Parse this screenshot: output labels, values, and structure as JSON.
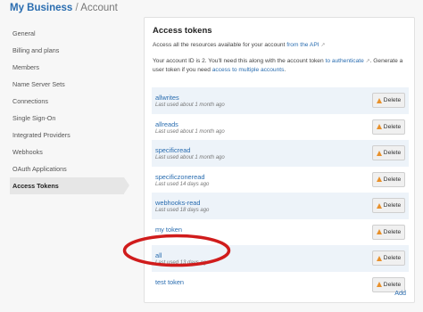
{
  "breadcrumb": {
    "business": "My Business",
    "separator": "/",
    "current": "Account"
  },
  "sidebar": {
    "items": [
      {
        "label": "General",
        "active": false
      },
      {
        "label": "Billing and plans",
        "active": false
      },
      {
        "label": "Members",
        "active": false
      },
      {
        "label": "Name Server Sets",
        "active": false
      },
      {
        "label": "Connections",
        "active": false
      },
      {
        "label": "Single Sign-On",
        "active": false
      },
      {
        "label": "Integrated Providers",
        "active": false
      },
      {
        "label": "Webhooks",
        "active": false
      },
      {
        "label": "OAuth Applications",
        "active": false
      },
      {
        "label": "Access Tokens",
        "active": true
      }
    ]
  },
  "panel": {
    "title": "Access tokens",
    "p1_text": "Access all the resources available for your account",
    "p1_link": "from the API",
    "p2_text_a": "Your account ID is 2. You'll need this along with the account token",
    "p2_link1": "to authenticate",
    "p2_text_b": ". Generate a user token if you need",
    "p2_link2": "access to multiple accounts",
    "p2_text_c": ".",
    "external_icon": "external-link-icon"
  },
  "tokens": [
    {
      "name": "allwrites",
      "last_used": "Last used about 1 month ago"
    },
    {
      "name": "allreads",
      "last_used": "Last used about 1 month ago"
    },
    {
      "name": "specificread",
      "last_used": "Last used about 1 month ago"
    },
    {
      "name": "specificzoneread",
      "last_used": "Last used 14 days ago"
    },
    {
      "name": "webhooks-read",
      "last_used": "Last used 18 days ago"
    },
    {
      "name": "my token",
      "last_used": ""
    },
    {
      "name": "all",
      "last_used": "Last used 13 days ago"
    },
    {
      "name": "test token",
      "last_used": ""
    }
  ],
  "delete_label": "Delete",
  "add_label": "Add",
  "colors": {
    "link": "#2a6db0",
    "row_shade": "#edf3f9",
    "warning": "#e8902a",
    "annotation": "#d01c1c"
  }
}
